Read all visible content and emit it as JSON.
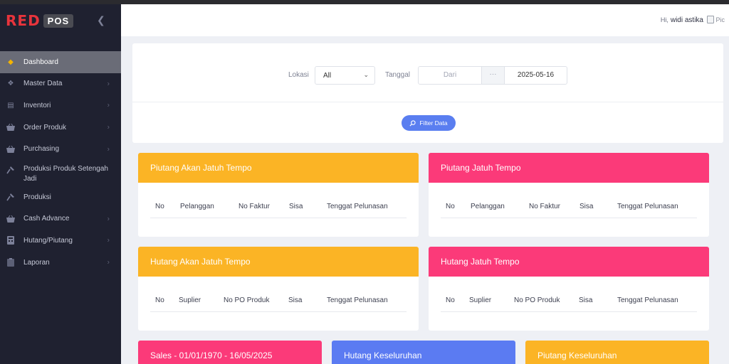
{
  "brand": {
    "red": "RED",
    "pos": "POS"
  },
  "sidebar": {
    "items": [
      {
        "label": "Dashboard",
        "icon": "diamond-icon",
        "active": true,
        "chevron": false
      },
      {
        "label": "Master Data",
        "icon": "nodes-icon",
        "active": false,
        "chevron": true
      },
      {
        "label": "Inventori",
        "icon": "box-icon",
        "active": false,
        "chevron": true
      },
      {
        "label": "Order Produk",
        "icon": "basket-icon",
        "active": false,
        "chevron": true
      },
      {
        "label": "Purchasing",
        "icon": "basket-icon",
        "active": false,
        "chevron": true
      },
      {
        "label": "Produksi Produk Setengah Jadi",
        "icon": "hammer-icon",
        "active": false,
        "chevron": false
      },
      {
        "label": "Produksi",
        "icon": "hammer-icon",
        "active": false,
        "chevron": false
      },
      {
        "label": "Cash Advance",
        "icon": "basket-icon",
        "active": false,
        "chevron": true
      },
      {
        "label": "Hutang/Piutang",
        "icon": "calculator-icon",
        "active": false,
        "chevron": true
      },
      {
        "label": "Laporan",
        "icon": "clipboard-icon",
        "active": false,
        "chevron": true
      }
    ]
  },
  "header": {
    "greeting": "Hi,",
    "user": "widi astika",
    "avatar_alt": "Pic"
  },
  "filter": {
    "lokasi_label": "Lokasi",
    "lokasi_value": "All",
    "tanggal_label": "Tanggal",
    "from_placeholder": "Dari",
    "separator": "···",
    "to_value": "2025-05-16",
    "button_label": "Filter Data"
  },
  "cards": {
    "piutang_akan": {
      "title": "Piutang Akan Jatuh Tempo",
      "columns": [
        "No",
        "Pelanggan",
        "No Faktur",
        "Sisa",
        "Tenggat Pelunasan"
      ]
    },
    "piutang_jatuh": {
      "title": "Piutang Jatuh Tempo",
      "columns": [
        "No",
        "Pelanggan",
        "No Faktur",
        "Sisa",
        "Tenggat Pelunasan"
      ]
    },
    "hutang_akan": {
      "title": "Hutang Akan Jatuh Tempo",
      "columns": [
        "No",
        "Suplier",
        "No PO Produk",
        "Sisa",
        "Tenggat Pelunasan"
      ]
    },
    "hutang_jatuh": {
      "title": "Hutang Jatuh Tempo",
      "columns": [
        "No",
        "Suplier",
        "No PO Produk",
        "Sisa",
        "Tenggat Pelunasan"
      ]
    },
    "sales": {
      "title": "Sales - 01/01/1970 - 16/05/2025"
    },
    "hutang_total": {
      "title": "Hutang Keseluruhan"
    },
    "piutang_total": {
      "title": "Piutang Keseluruhan"
    }
  },
  "colors": {
    "yellow": "#fbb425",
    "pink": "#fb3a79",
    "blue": "#5b7bf2",
    "sidebar": "#1f2130",
    "active": "#6a6c77",
    "brand_red": "#e8343c"
  }
}
